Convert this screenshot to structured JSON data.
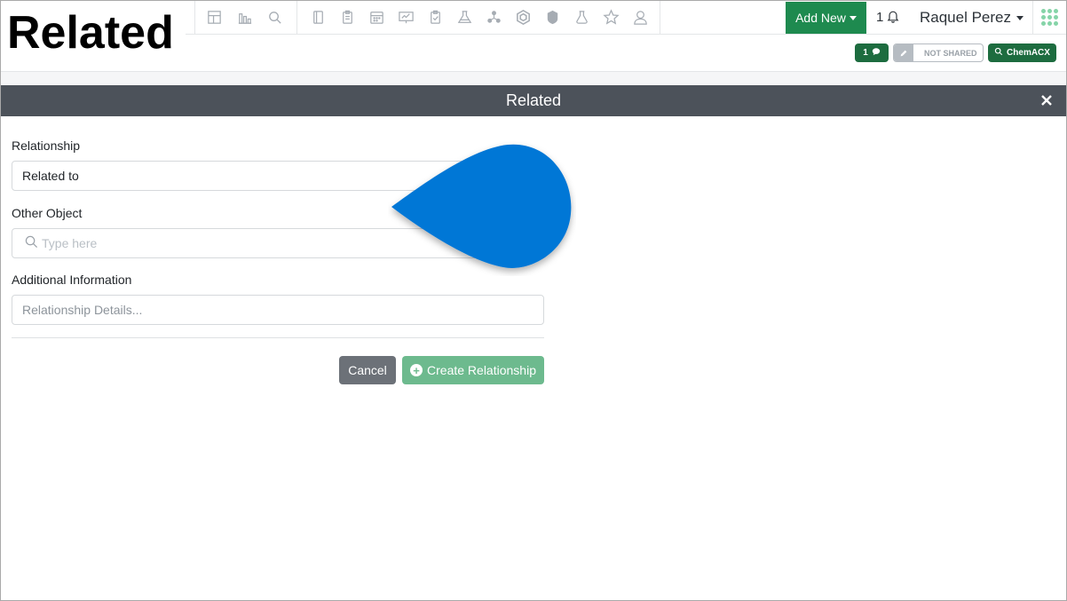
{
  "overlay_title": "Related",
  "nav": {
    "icons_group1": [
      "dashboard-icon",
      "bar-chart-icon",
      "search-icon"
    ],
    "icons_group2": [
      "notebook-icon",
      "clipboard-icon",
      "calendar-icon",
      "presentation-icon",
      "task-icon",
      "flask-icon",
      "molecule-icon",
      "hexagon-icon",
      "shield-icon",
      "beaker-icon",
      "star-icon",
      "user-icon"
    ],
    "add_new_label": "Add New",
    "notification_count": "1",
    "user_name": "Raquel Perez",
    "accent_color": "#1e8a4f"
  },
  "subbar": {
    "comments_count": "1",
    "shared_label": "NOT SHARED",
    "chem_label": "ChemACX"
  },
  "modal": {
    "title": "Related",
    "relationship_label": "Relationship",
    "relationship_value": "Related to",
    "other_object_label": "Other Object",
    "other_object_placeholder": "Type here",
    "additional_info_label": "Additional Information",
    "additional_info_placeholder": "Relationship Details...",
    "cancel_label": "Cancel",
    "create_label": "Create Relationship"
  }
}
